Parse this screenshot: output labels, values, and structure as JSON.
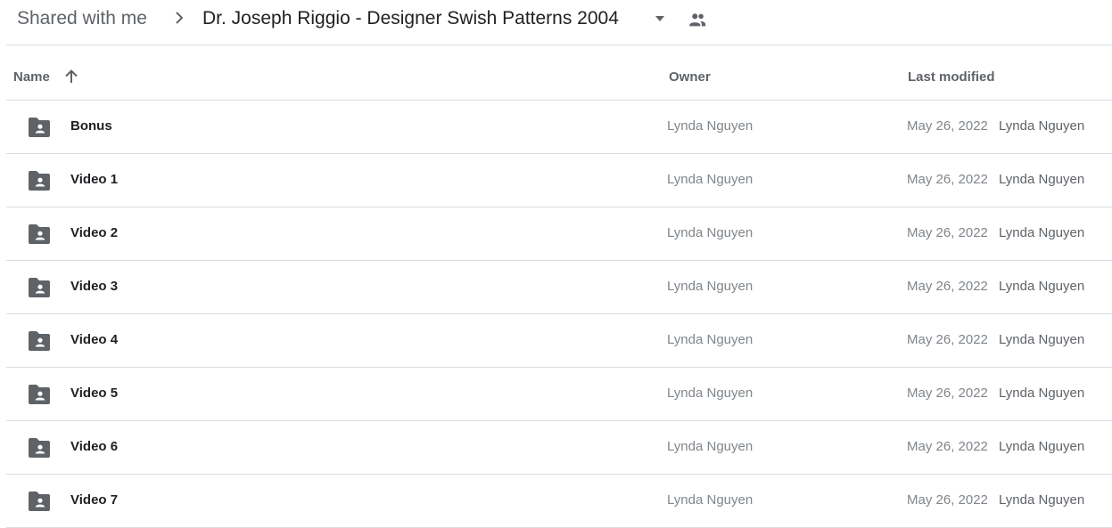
{
  "breadcrumb": {
    "root": "Shared with me",
    "separator_icon": "chevron-right-icon",
    "current": "Dr. Joseph Riggio - Designer Swish Patterns 2004",
    "dropdown_icon": "caret-down-icon",
    "shared_icon": "people-icon"
  },
  "columns": {
    "name": "Name",
    "sort_icon": "arrow-up-icon",
    "owner": "Owner",
    "last_modified": "Last modified"
  },
  "rows": [
    {
      "name": "Bonus",
      "icon": "shared-folder-icon",
      "owner": "Lynda Nguyen",
      "date": "May 26, 2022",
      "modified_by": "Lynda Nguyen"
    },
    {
      "name": "Video 1",
      "icon": "shared-folder-icon",
      "owner": "Lynda Nguyen",
      "date": "May 26, 2022",
      "modified_by": "Lynda Nguyen"
    },
    {
      "name": "Video 2",
      "icon": "shared-folder-icon",
      "owner": "Lynda Nguyen",
      "date": "May 26, 2022",
      "modified_by": "Lynda Nguyen"
    },
    {
      "name": "Video 3",
      "icon": "shared-folder-icon",
      "owner": "Lynda Nguyen",
      "date": "May 26, 2022",
      "modified_by": "Lynda Nguyen"
    },
    {
      "name": "Video 4",
      "icon": "shared-folder-icon",
      "owner": "Lynda Nguyen",
      "date": "May 26, 2022",
      "modified_by": "Lynda Nguyen"
    },
    {
      "name": "Video 5",
      "icon": "shared-folder-icon",
      "owner": "Lynda Nguyen",
      "date": "May 26, 2022",
      "modified_by": "Lynda Nguyen"
    },
    {
      "name": "Video 6",
      "icon": "shared-folder-icon",
      "owner": "Lynda Nguyen",
      "date": "May 26, 2022",
      "modified_by": "Lynda Nguyen"
    },
    {
      "name": "Video 7",
      "icon": "shared-folder-icon",
      "owner": "Lynda Nguyen",
      "date": "May 26, 2022",
      "modified_by": "Lynda Nguyen"
    }
  ],
  "colors": {
    "icon": "#5f6368",
    "divider": "#dadce0",
    "primary_text": "#202124",
    "secondary_text": "#80868b"
  }
}
